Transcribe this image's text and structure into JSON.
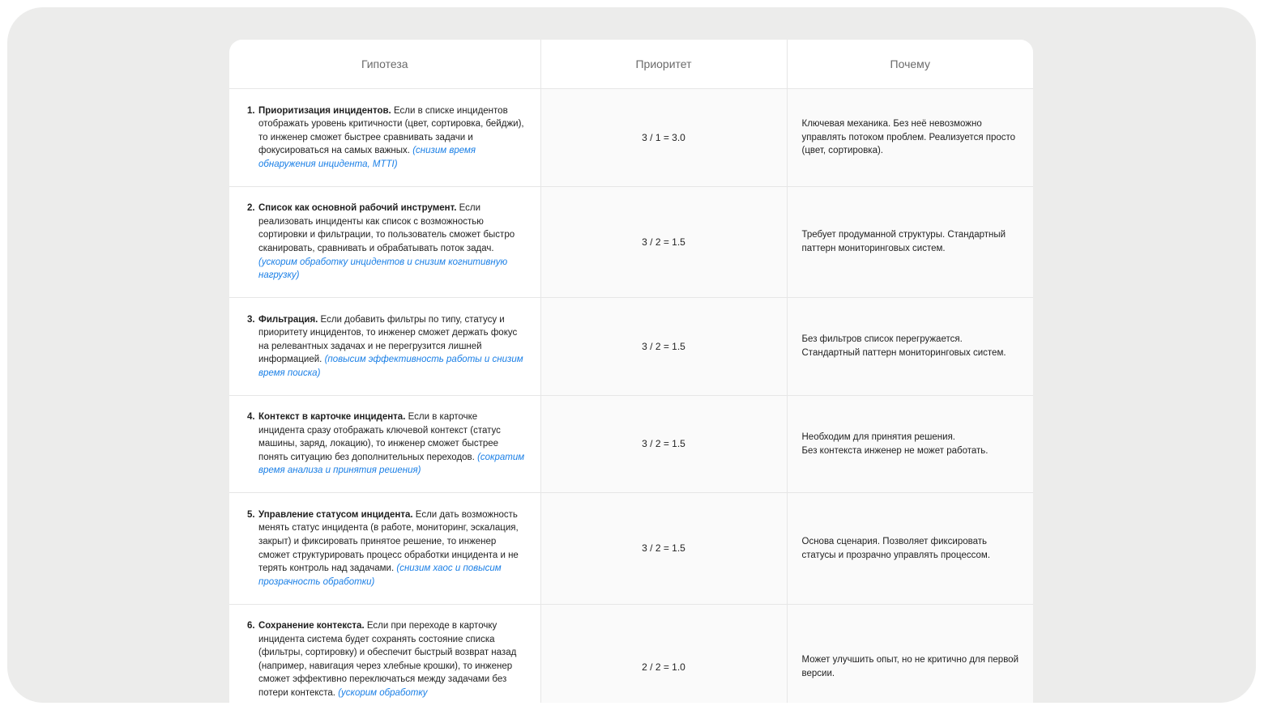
{
  "table": {
    "headers": [
      "Гипотеза",
      "Приоритет",
      "Почему"
    ],
    "rows": [
      {
        "num": "1.",
        "title": "Приоритизация инцидентов.",
        "text": " Если в списке инцидентов отображать уровень критичности (цвет, сортировка, бейджи), то инженер сможет быстрее сравнивать задачи и фокусироваться на самых важных. ",
        "link": "(снизим время обнаружения инцидента, MTTI)",
        "priority": "3 / 1 = 3.0",
        "why": [
          "Ключевая механика. Без неё невозможно управлять потоком проблем. Реализуется просто (цвет, сортировка)."
        ]
      },
      {
        "num": "2.",
        "title": "Список как основной рабочий инструмент.",
        "text": " Если реализовать инциденты как список с возможностью сортировки и фильтрации, то пользователь сможет быстро сканировать, сравнивать и обрабатывать поток задач. ",
        "link": "(ускорим обработку инцидентов и снизим когнитивную нагрузку)",
        "priority": "3 / 2 = 1.5",
        "why": [
          "Требует продуманной структуры. Стандартный паттерн мониторинговых систем."
        ]
      },
      {
        "num": "3.",
        "title": "Фильтрация.",
        "text": " Если добавить фильтры по типу, статусу и приоритету инцидентов, то инженер сможет держать фокус на релевантных задачах и не перегрузится лишней информацией. ",
        "link": "(повысим эффективность работы и снизим время поиска)",
        "priority": "3 / 2 = 1.5",
        "why": [
          "Без фильтров список перегружается.",
          "Стандартный паттерн мониторинговых систем."
        ]
      },
      {
        "num": "4.",
        "title": "Контекст в карточке инцидента.",
        "text": " Если в карточке инцидента сразу отображать ключевой контекст (статус машины, заряд, локацию), то инженер сможет быстрее понять ситуацию без дополнительных переходов. ",
        "link": "(сократим время анализа и принятия решения)",
        "priority": "3 / 2 = 1.5",
        "why": [
          "Необходим для принятия решения.",
          "Без контекста инженер не может работать."
        ]
      },
      {
        "num": "5.",
        "title": "Управление статусом инцидента.",
        "text": " Если дать возможность менять статус инцидента (в работе, мониторинг, эскалация, закрыт) и фиксировать принятое решение, то инженер сможет структурировать процесс обработки инцидента и не терять контроль над задачами. ",
        "link": "(снизим хаос и повысим прозрачность обработки)",
        "priority": "3 / 2 = 1.5",
        "why": [
          "Основа сценария. Позволяет фиксировать статусы и прозрачно управлять процессом."
        ]
      },
      {
        "num": "6.",
        "title": "Сохранение контекста.",
        "text": " Если при переходе в карточку инцидента система будет сохранять состояние списка (фильтры, сортировку) и обеспечит быстрый возврат назад (например, навигация через хлебные крошки), то инженер сможет эффективно переключаться между задачами без потери контекста. ",
        "link": "(ускорим обработку",
        "priority": "2 / 2 = 1.0",
        "why": [
          "Может улучшить опыт, но не критично для первой версии."
        ]
      }
    ]
  }
}
